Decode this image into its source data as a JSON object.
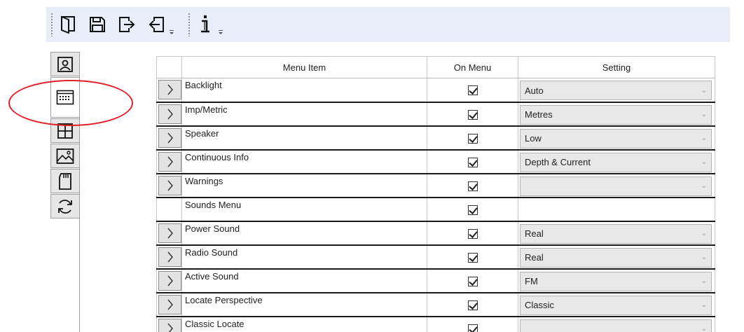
{
  "toolbar": {
    "buttons": [
      {
        "name": "open-icon"
      },
      {
        "name": "save-icon"
      },
      {
        "name": "export-icon"
      },
      {
        "name": "import-icon"
      },
      {
        "name": "info-icon"
      }
    ]
  },
  "sidebar": {
    "tabs": [
      {
        "name": "profile-icon",
        "active": false
      },
      {
        "name": "menu-list-icon",
        "active": true
      },
      {
        "name": "grid-layout-icon",
        "active": false
      },
      {
        "name": "image-icon",
        "active": false
      },
      {
        "name": "memory-card-icon",
        "active": false
      },
      {
        "name": "sync-icon",
        "active": false
      }
    ]
  },
  "highlight": {
    "color": "#e0202a"
  },
  "grid": {
    "columns": [
      "Menu Item",
      "On Menu",
      "Setting"
    ],
    "rows": [
      {
        "item": "Backlight",
        "on_menu": true,
        "setting": "Auto",
        "expander": true,
        "combo": true
      },
      {
        "item": "Imp/Metric",
        "on_menu": true,
        "setting": "Metres",
        "expander": true,
        "combo": true
      },
      {
        "item": "Speaker",
        "on_menu": true,
        "setting": "Low",
        "expander": true,
        "combo": true
      },
      {
        "item": "Continuous Info",
        "on_menu": true,
        "setting": "Depth & Current",
        "expander": true,
        "combo": true
      },
      {
        "item": "Warnings",
        "on_menu": true,
        "setting": "",
        "expander": true,
        "combo": true
      },
      {
        "item": "Sounds Menu",
        "on_menu": true,
        "setting": "",
        "expander": false,
        "combo": false
      },
      {
        "item": "Power Sound",
        "on_menu": true,
        "setting": "Real",
        "expander": true,
        "combo": true
      },
      {
        "item": "Radio Sound",
        "on_menu": true,
        "setting": "Real",
        "expander": true,
        "combo": true
      },
      {
        "item": "Active Sound",
        "on_menu": true,
        "setting": "FM",
        "expander": true,
        "combo": true
      },
      {
        "item": "Locate Perspective",
        "on_menu": true,
        "setting": "Classic",
        "expander": true,
        "combo": true
      },
      {
        "item": "Classic Locate",
        "on_menu": true,
        "setting": "",
        "expander": true,
        "combo": true
      }
    ]
  }
}
